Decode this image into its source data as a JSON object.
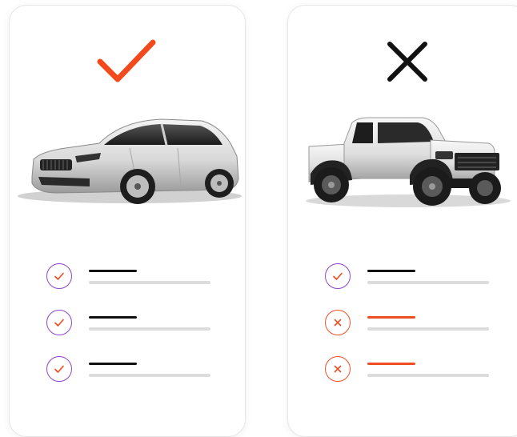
{
  "colors": {
    "check": "#F24A1D",
    "cross": "#111111",
    "ok_ring": "#8E44C8",
    "bad_ring": "#E8502A",
    "line_dark": "#111111",
    "line_red": "#EE4E22",
    "line_light": "#DCDCDC"
  },
  "cards": [
    {
      "verdict_icon": "checkmark-icon",
      "image": "sedan-car-image",
      "rows": [
        {
          "status": "ok",
          "icon": "circle-check-icon"
        },
        {
          "status": "ok",
          "icon": "circle-check-icon"
        },
        {
          "status": "ok",
          "icon": "circle-check-icon"
        }
      ]
    },
    {
      "verdict_icon": "cross-icon",
      "image": "pickup-truck-image",
      "rows": [
        {
          "status": "ok",
          "icon": "circle-check-icon"
        },
        {
          "status": "bad",
          "icon": "circle-x-icon"
        },
        {
          "status": "bad",
          "icon": "circle-x-icon"
        }
      ]
    }
  ]
}
